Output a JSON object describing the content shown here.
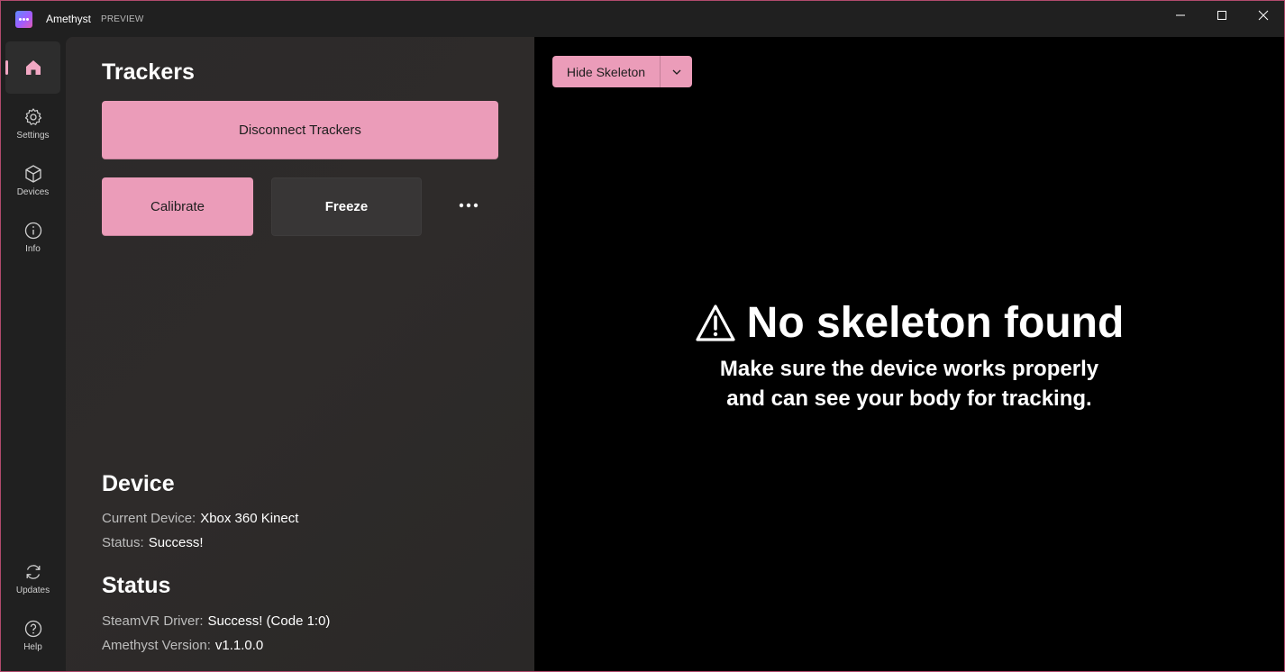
{
  "window": {
    "title": "Amethyst",
    "badge": "PREVIEW",
    "accent_color": "#eb9cb9",
    "controls": [
      "minimize-icon",
      "maximize-icon",
      "close-icon"
    ]
  },
  "sidebar": {
    "items": [
      {
        "label": "",
        "icon": "home-icon",
        "active": true
      },
      {
        "label": "Settings",
        "icon": "gear-icon"
      },
      {
        "label": "Devices",
        "icon": "cube-icon"
      },
      {
        "label": "Info",
        "icon": "info-icon"
      },
      {
        "label": "Updates",
        "icon": "refresh-icon"
      },
      {
        "label": "Help",
        "icon": "help-icon"
      }
    ]
  },
  "trackers": {
    "heading": "Trackers",
    "disconnect_label": "Disconnect Trackers",
    "calibrate_label": "Calibrate",
    "freeze_label": "Freeze",
    "more_icon": "more-icon"
  },
  "device": {
    "heading": "Device",
    "current_device_key": "Current Device:",
    "current_device_value": "Xbox 360 Kinect",
    "status_key": "Status:",
    "status_value": "Success!"
  },
  "status": {
    "heading": "Status",
    "driver_key": "SteamVR Driver:",
    "driver_value": "Success! (Code 1:0)",
    "version_key": "Amethyst Version:",
    "version_value": "v1.1.0.0"
  },
  "viewer": {
    "toggle_label": "Hide Skeleton",
    "empty_title": "No skeleton found",
    "empty_line1": "Make sure the device works properly",
    "empty_line2": "and can see your body for tracking."
  }
}
